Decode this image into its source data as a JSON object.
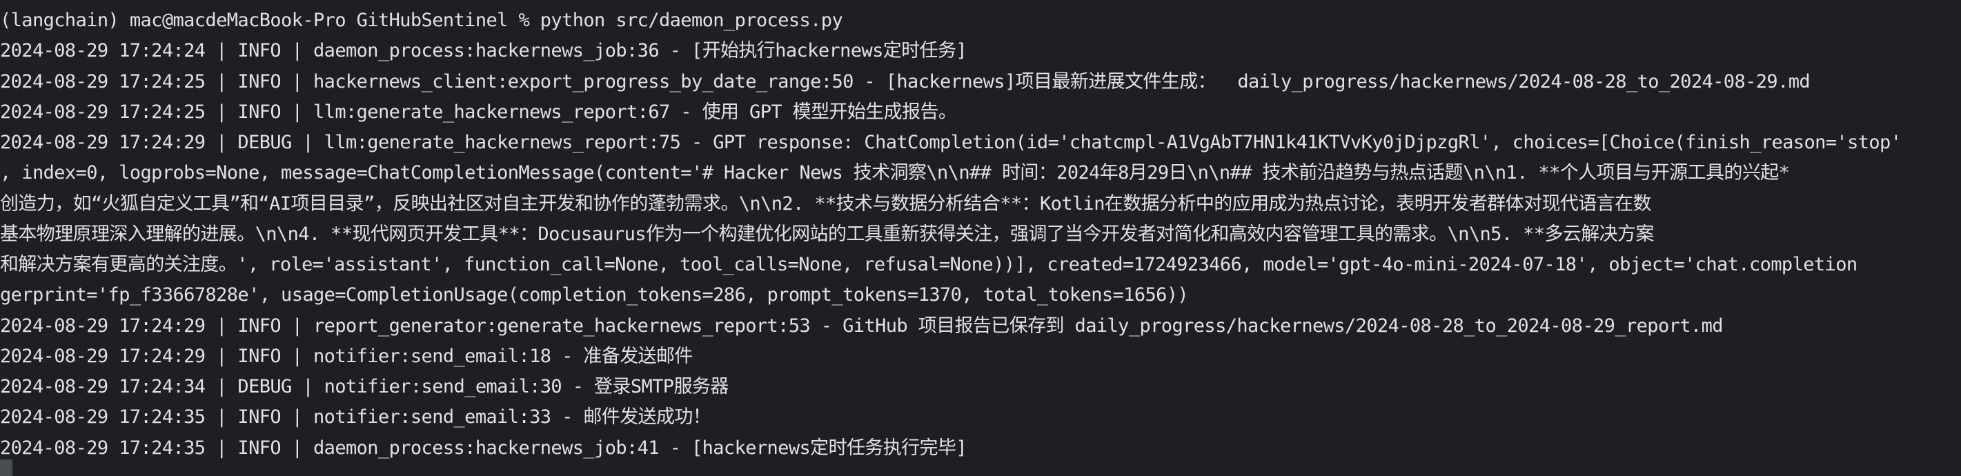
{
  "terminal": {
    "lines": [
      "(langchain) mac@macdeMacBook-Pro GitHubSentinel % python src/daemon_process.py",
      "2024-08-29 17:24:24 | INFO | daemon_process:hackernews_job:36 - [开始执行hackernews定时任务]",
      "2024-08-29 17:24:25 | INFO | hackernews_client:export_progress_by_date_range:50 - [hackernews]项目最新进展文件生成：  daily_progress/hackernews/2024-08-28_to_2024-08-29.md",
      "2024-08-29 17:24:25 | INFO | llm:generate_hackernews_report:67 - 使用 GPT 模型开始生成报告。",
      "2024-08-29 17:24:29 | DEBUG | llm:generate_hackernews_report:75 - GPT response: ChatCompletion(id='chatcmpl-A1VgAbT7HN1k41KTVvKy0jDjpzgRl', choices=[Choice(finish_reason='stop'",
      ", index=0, logprobs=None, message=ChatCompletionMessage(content='# Hacker News 技术洞察\\n\\n## 时间：2024年8月29日\\n\\n## 技术前沿趋势与热点话题\\n\\n1. **个人项目与开源工具的兴起*",
      "创造力，如“火狐自定义工具”和“AI项目目录”，反映出社区对自主开发和协作的蓬勃需求。\\n\\n2. **技术与数据分析结合**：Kotlin在数据分析中的应用成为热点讨论，表明开发者群体对现代语言在数",
      "基本物理原理深入理解的进展。\\n\\n4. **现代网页开发工具**：Docusaurus作为一个构建优化网站的工具重新获得关注，强调了当今开发者对简化和高效内容管理工具的需求。\\n\\n5. **多云解决方案",
      "和解决方案有更高的关注度。', role='assistant', function_call=None, tool_calls=None, refusal=None))], created=1724923466, model='gpt-4o-mini-2024-07-18', object='chat.completion",
      "gerprint='fp_f33667828e', usage=CompletionUsage(completion_tokens=286, prompt_tokens=1370, total_tokens=1656))",
      "2024-08-29 17:24:29 | INFO | report_generator:generate_hackernews_report:53 - GitHub 项目报告已保存到 daily_progress/hackernews/2024-08-28_to_2024-08-29_report.md",
      "2024-08-29 17:24:29 | INFO | notifier:send_email:18 - 准备发送邮件",
      "2024-08-29 17:24:34 | DEBUG | notifier:send_email:30 - 登录SMTP服务器",
      "2024-08-29 17:24:35 | INFO | notifier:send_email:33 - 邮件发送成功！",
      "2024-08-29 17:24:35 | INFO | daemon_process:hackernews_job:41 - [hackernews定时任务执行完毕]"
    ]
  },
  "colors": {
    "background": "#1e1f22",
    "text": "#dfe1e5",
    "cursor": "#4a4d52"
  }
}
